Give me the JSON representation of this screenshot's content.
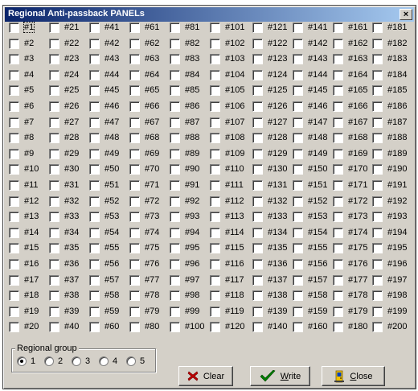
{
  "window": {
    "title": "Regional Anti-passback PANELs",
    "close_glyph": "×"
  },
  "panels": {
    "labels": [
      "#1",
      "#2",
      "#3",
      "#4",
      "#5",
      "#6",
      "#7",
      "#8",
      "#9",
      "#10",
      "#11",
      "#12",
      "#13",
      "#14",
      "#15",
      "#16",
      "#17",
      "#18",
      "#19",
      "#20",
      "#21",
      "#22",
      "#23",
      "#24",
      "#25",
      "#26",
      "#27",
      "#28",
      "#29",
      "#30",
      "#31",
      "#32",
      "#33",
      "#34",
      "#35",
      "#36",
      "#37",
      "#38",
      "#39",
      "#40",
      "#41",
      "#42",
      "#43",
      "#44",
      "#45",
      "#46",
      "#47",
      "#48",
      "#49",
      "#50",
      "#51",
      "#52",
      "#53",
      "#54",
      "#55",
      "#56",
      "#57",
      "#58",
      "#59",
      "#60",
      "#61",
      "#62",
      "#63",
      "#64",
      "#65",
      "#66",
      "#67",
      "#68",
      "#69",
      "#70",
      "#71",
      "#72",
      "#73",
      "#74",
      "#75",
      "#76",
      "#77",
      "#78",
      "#79",
      "#80",
      "#81",
      "#82",
      "#83",
      "#84",
      "#85",
      "#86",
      "#87",
      "#88",
      "#89",
      "#90",
      "#91",
      "#92",
      "#93",
      "#94",
      "#95",
      "#96",
      "#97",
      "#98",
      "#99",
      "#100",
      "#101",
      "#102",
      "#103",
      "#104",
      "#105",
      "#106",
      "#107",
      "#108",
      "#109",
      "#110",
      "#111",
      "#112",
      "#113",
      "#114",
      "#115",
      "#116",
      "#117",
      "#118",
      "#119",
      "#120",
      "#121",
      "#122",
      "#123",
      "#124",
      "#125",
      "#126",
      "#127",
      "#128",
      "#129",
      "#130",
      "#131",
      "#132",
      "#133",
      "#134",
      "#135",
      "#136",
      "#137",
      "#138",
      "#139",
      "#140",
      "#141",
      "#142",
      "#143",
      "#144",
      "#145",
      "#146",
      "#147",
      "#148",
      "#149",
      "#150",
      "#151",
      "#152",
      "#153",
      "#154",
      "#155",
      "#156",
      "#157",
      "#158",
      "#159",
      "#160",
      "#161",
      "#162",
      "#163",
      "#164",
      "#165",
      "#166",
      "#167",
      "#168",
      "#169",
      "#170",
      "#171",
      "#172",
      "#173",
      "#174",
      "#175",
      "#176",
      "#177",
      "#178",
      "#179",
      "#180",
      "#181",
      "#182",
      "#183",
      "#184",
      "#185",
      "#186",
      "#187",
      "#188",
      "#189",
      "#190",
      "#191",
      "#192",
      "#193",
      "#194",
      "#195",
      "#196",
      "#197",
      "#198",
      "#199",
      "#200"
    ],
    "checked": [],
    "focused": "#1"
  },
  "regional_group": {
    "label": "Regional group",
    "options": [
      "1",
      "2",
      "3",
      "4",
      "5"
    ],
    "selected": "1"
  },
  "buttons": {
    "clear": {
      "label": "Clear",
      "icon": "red-x-icon"
    },
    "write": {
      "label": "Write",
      "icon": "green-checkmark-icon"
    },
    "close": {
      "label": "Close",
      "icon": "exit-door-icon"
    }
  },
  "colors": {
    "title_bar_start": "#0a246a",
    "title_bar_end": "#a6caf0",
    "face": "#d4d0c8"
  }
}
